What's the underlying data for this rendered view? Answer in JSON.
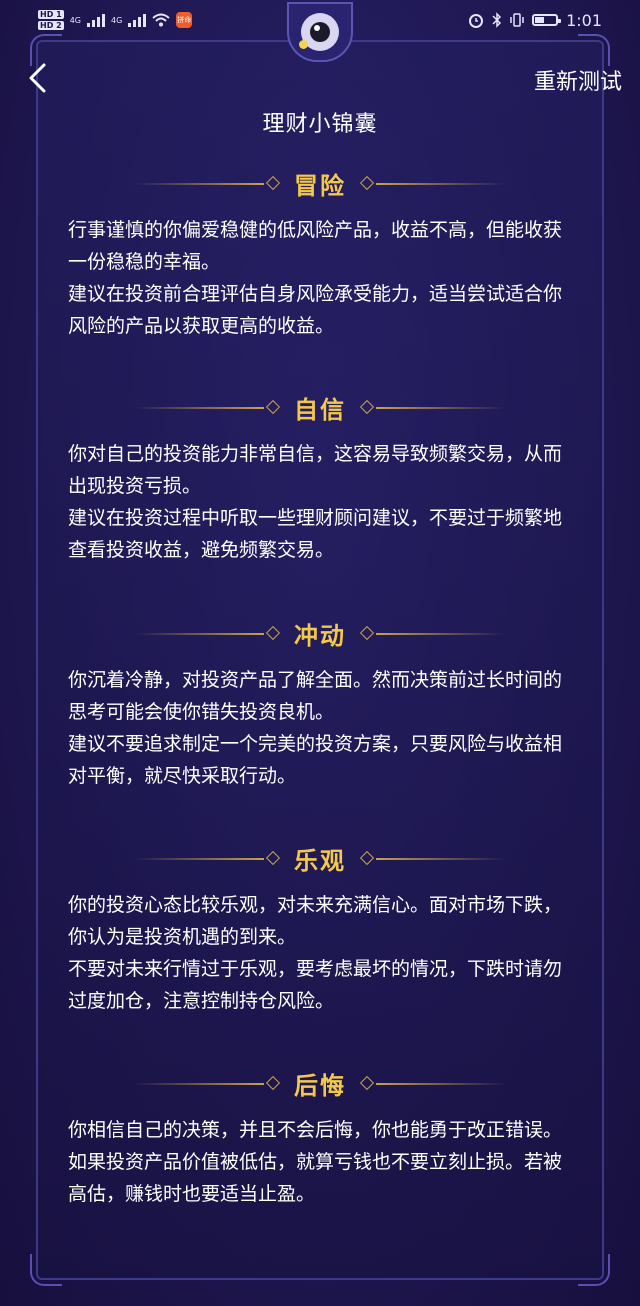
{
  "status_bar": {
    "hd1": "HD 1",
    "hd2": "HD 2",
    "net1": "4G",
    "net2": "4G",
    "app_badge": "拼命",
    "time": "1:01"
  },
  "header": {
    "retest_label": "重新测试",
    "title": "理财小锦囊"
  },
  "sections": [
    {
      "title": "冒险",
      "desc": "行事谨慎的你偏爱稳健的低风险产品，收益不高，但能收获一份稳稳的幸福。",
      "advice": "建议在投资前合理评估自身风险承受能力，适当尝试适合你风险的产品以获取更高的收益。"
    },
    {
      "title": "自信",
      "desc": "你对自己的投资能力非常自信，这容易导致频繁交易，从而出现投资亏损。",
      "advice": "建议在投资过程中听取一些理财顾问建议，不要过于频繁地查看投资收益，避免频繁交易。"
    },
    {
      "title": "冲动",
      "desc": "你沉着冷静，对投资产品了解全面。然而决策前过长时间的思考可能会使你错失投资良机。",
      "advice": "建议不要追求制定一个完美的投资方案，只要风险与收益相对平衡，就尽快采取行动。"
    },
    {
      "title": "乐观",
      "desc": "你的投资心态比较乐观，对未来充满信心。面对市场下跌，你认为是投资机遇的到来。",
      "advice": "不要对未来行情过于乐观，要考虑最坏的情况，下跌时请勿过度加仓，注意控制持仓风险。"
    },
    {
      "title": "后悔",
      "desc": "你相信自己的决策，并且不会后悔，你也能勇于改正错误。",
      "advice": "如果投资产品价值被低估，就算亏钱也不要立刻止损。若被高估，赚钱时也要适当止盈。"
    }
  ],
  "colors": {
    "background": "#1c1546",
    "accent_gold": "#f4c94a",
    "line_gold": "#c9a24a",
    "frame_border": "#3e3a8a"
  }
}
